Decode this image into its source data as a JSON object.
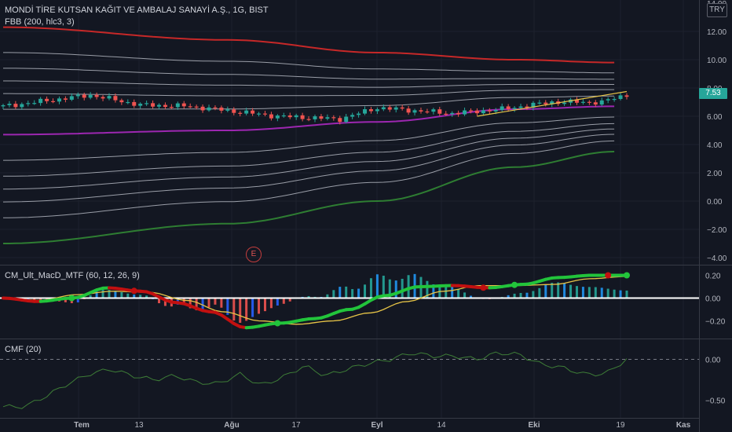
{
  "title": "MONDİ TİRE KUTSAN KAĞIT VE AMBALAJ SANAYİ A.Ş., 1G, BIST",
  "indicator_main": "FBB (200, hlc3, 3)",
  "currency_badge": "TRY",
  "last_price": "7.53",
  "earnings_marker": "E",
  "colors": {
    "background": "#131722",
    "up": "#26a69a",
    "down": "#ef5350",
    "upper_band": "#c62828",
    "basis": "#9c27b0",
    "lower_band": "#2e7d32",
    "fib_lines": "#b2b5be",
    "ma_line": "#e8c547",
    "macd_up": "#22c43b",
    "macd_down": "#c21010",
    "cmf_line": "#3e7d37"
  },
  "price_pane": {
    "y_ticks": [
      "14.00",
      "12.00",
      "10.00",
      "8.00",
      "6.00",
      "4.00",
      "2.00",
      "0.00",
      "−2.00",
      "−4.00"
    ]
  },
  "macd_pane": {
    "label": "CM_Ult_MacD_MTF (60, 12, 26, 9)",
    "y_ticks": [
      "0.20",
      "0.00",
      "−0.20"
    ]
  },
  "cmf_pane": {
    "label": "CMF (20)",
    "y_ticks": [
      "0.00",
      "−0.50"
    ]
  },
  "x_axis": {
    "labels": [
      "Tem",
      "13",
      "Ağu",
      "17",
      "Eyl",
      "14",
      "Eki",
      "19",
      "Kas"
    ]
  },
  "chart_data": [
    {
      "type": "line",
      "title": "MONDİ TİRE KUTSAN KAĞIT VE AMBALAJ SANAYİ A.Ş., 1G, BIST",
      "ylim": [
        -4.3,
        14
      ],
      "x_labels": [
        "Tem",
        "13",
        "Ağu",
        "17",
        "Eyl",
        "14",
        "Eki",
        "19",
        "Kas"
      ],
      "n_bars": 101,
      "series": [
        {
          "name": "FBB (200, hlc3, 3)",
          "values": [
            {
              "x": "start",
              "upper": 12.3,
              "basis": 4.7,
              "lower": -3.0
            },
            {
              "x": "Ağu",
              "upper": 11.4,
              "basis": 5.0,
              "lower": -1.6
            },
            {
              "x": "Eyl",
              "upper": 10.5,
              "basis": 5.6,
              "lower": 0.0
            },
            {
              "x": "Eki",
              "upper": 10.0,
              "basis": 6.5,
              "lower": 2.4
            },
            {
              "x": "19",
              "upper": 9.8,
              "basis": 6.7,
              "lower": 3.5
            }
          ]
        }
      ],
      "close_approx": [
        6.7,
        7.5,
        6.8,
        6.7,
        6.0,
        5.8,
        6.6,
        6.2,
        6.5,
        7.0,
        7.0,
        7.53
      ],
      "last": 7.53
    },
    {
      "type": "line",
      "title": "CM_Ult_MacD_MTF (60, 12, 26, 9)",
      "ylim": [
        -0.33,
        0.25
      ],
      "macd_approx": [
        0.0,
        -0.03,
        0.0,
        0.09,
        0.06,
        -0.04,
        -0.12,
        -0.26,
        -0.22,
        -0.18,
        -0.1,
        0.02,
        0.1,
        0.11,
        0.09,
        0.12,
        0.18,
        0.2,
        0.2
      ],
      "signal_approx": [
        0.0,
        -0.02,
        0.03,
        0.06,
        0.05,
        -0.02,
        -0.12,
        -0.2,
        -0.23,
        -0.2,
        -0.13,
        -0.03,
        0.06,
        0.11,
        0.11,
        0.12,
        0.17,
        0.19
      ]
    },
    {
      "type": "line",
      "title": "CMF (20)",
      "ylim": [
        -0.6,
        0.12
      ],
      "values_approx": [
        -0.58,
        -0.58,
        -0.45,
        -0.3,
        -0.18,
        -0.12,
        -0.2,
        -0.25,
        -0.2,
        -0.28,
        -0.3,
        -0.18,
        -0.32,
        -0.22,
        -0.08,
        -0.2,
        -0.12,
        -0.05,
        0.0,
        0.08,
        0.04,
        0.04,
        0.0,
        0.08,
        0.06,
        -0.06,
        -0.1,
        -0.18,
        -0.18,
        0.0
      ]
    }
  ]
}
